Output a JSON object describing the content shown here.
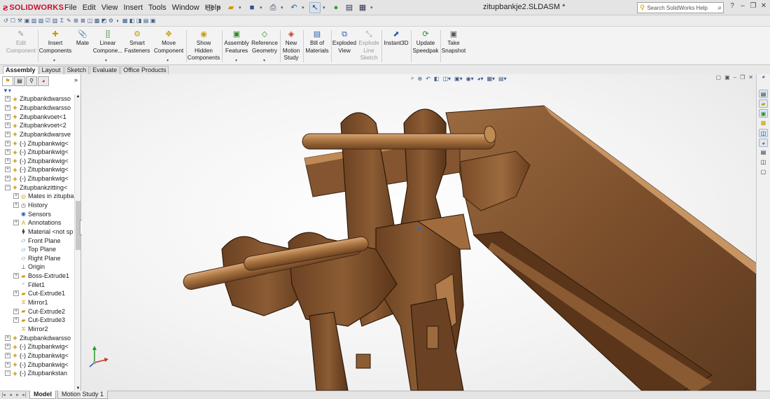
{
  "app": {
    "logo_text": "SOLIDWORKS",
    "document_title": "zitupbankje2.SLDASM *"
  },
  "menu": [
    "File",
    "Edit",
    "View",
    "Insert",
    "Tools",
    "Window",
    "Help"
  ],
  "search": {
    "placeholder": "Search SolidWorks Help"
  },
  "ribbon": {
    "buttons": [
      {
        "label": "Edit\nComponent",
        "enabled": false,
        "icon": "edit-component-icon"
      },
      {
        "label": "Insert\nComponents",
        "enabled": true,
        "icon": "insert-components-icon"
      },
      {
        "label": "Mate",
        "enabled": true,
        "icon": "mate-icon"
      },
      {
        "label": "Linear\nCompone...",
        "enabled": true,
        "icon": "linear-pattern-icon"
      },
      {
        "label": "Smart\nFasteners",
        "enabled": true,
        "icon": "smart-fasteners-icon"
      },
      {
        "label": "Move\nComponent",
        "enabled": true,
        "icon": "move-component-icon"
      },
      {
        "label": "Show\nHidden\nComponents",
        "enabled": true,
        "icon": "show-hidden-icon"
      },
      {
        "label": "Assembly\nFeatures",
        "enabled": true,
        "icon": "assembly-features-icon"
      },
      {
        "label": "Reference\nGeometry",
        "enabled": true,
        "icon": "reference-geometry-icon"
      },
      {
        "label": "New\nMotion\nStudy",
        "enabled": true,
        "icon": "motion-study-icon"
      },
      {
        "label": "Bill of\nMaterials",
        "enabled": true,
        "icon": "bom-icon"
      },
      {
        "label": "Exploded\nView",
        "enabled": true,
        "icon": "exploded-view-icon"
      },
      {
        "label": "Explode\nLine\nSketch",
        "enabled": false,
        "icon": "explode-line-icon"
      },
      {
        "label": "Instant3D",
        "enabled": true,
        "icon": "instant3d-icon"
      },
      {
        "label": "Update\nSpeedpak",
        "enabled": true,
        "icon": "speedpak-icon"
      },
      {
        "label": "Take\nSnapshot",
        "enabled": true,
        "icon": "snapshot-icon"
      }
    ]
  },
  "command_tabs": [
    {
      "label": "Assembly",
      "active": true
    },
    {
      "label": "Layout",
      "active": false
    },
    {
      "label": "Sketch",
      "active": false
    },
    {
      "label": "Evaluate",
      "active": false
    },
    {
      "label": "Office Products",
      "active": false
    }
  ],
  "tree": [
    {
      "label": "Zitupbankdwarsso",
      "level": 0,
      "toggle": "+",
      "icon": "component-icon"
    },
    {
      "label": "Zitupbankdwarsso",
      "level": 0,
      "toggle": "+",
      "icon": "component-icon"
    },
    {
      "label": "Zitupbankvoet<1",
      "level": 0,
      "toggle": "+",
      "icon": "component-icon"
    },
    {
      "label": "Zitupbankvoet<2",
      "level": 0,
      "toggle": "+",
      "icon": "component-icon"
    },
    {
      "label": "Zitupbankdwarsve",
      "level": 0,
      "toggle": "+",
      "icon": "component-icon"
    },
    {
      "label": "(-) Zitupbankwig<",
      "level": 0,
      "toggle": "+",
      "icon": "component-icon"
    },
    {
      "label": "(-) Zitupbankwig<",
      "level": 0,
      "toggle": "+",
      "icon": "component-icon"
    },
    {
      "label": "(-) Zitupbankwig<",
      "level": 0,
      "toggle": "+",
      "icon": "component-icon"
    },
    {
      "label": "(-) Zitupbankwig<",
      "level": 0,
      "toggle": "+",
      "icon": "component-icon"
    },
    {
      "label": "(-) Zitupbankwig<",
      "level": 0,
      "toggle": "+",
      "icon": "component-icon"
    },
    {
      "label": "Zitupbankzitting<",
      "level": 0,
      "toggle": "-",
      "icon": "component-icon"
    },
    {
      "label": "Mates in zitupba",
      "level": 1,
      "toggle": "+",
      "icon": "mates-icon"
    },
    {
      "label": "History",
      "level": 1,
      "toggle": "+",
      "icon": "history-icon"
    },
    {
      "label": "Sensors",
      "level": 1,
      "toggle": "",
      "icon": "sensors-icon"
    },
    {
      "label": "Annotations",
      "level": 1,
      "toggle": "+",
      "icon": "annotations-icon"
    },
    {
      "label": "Material <not sp",
      "level": 1,
      "toggle": "",
      "icon": "material-icon"
    },
    {
      "label": "Front Plane",
      "level": 1,
      "toggle": "",
      "icon": "plane-icon"
    },
    {
      "label": "Top Plane",
      "level": 1,
      "toggle": "",
      "icon": "plane-icon"
    },
    {
      "label": "Right Plane",
      "level": 1,
      "toggle": "",
      "icon": "plane-icon"
    },
    {
      "label": "Origin",
      "level": 1,
      "toggle": "",
      "icon": "origin-icon"
    },
    {
      "label": "Boss-Extrude1",
      "level": 1,
      "toggle": "+",
      "icon": "feature-icon"
    },
    {
      "label": "Fillet1",
      "level": 1,
      "toggle": "",
      "icon": "fillet-icon"
    },
    {
      "label": "Cut-Extrude1",
      "level": 1,
      "toggle": "+",
      "icon": "feature-icon"
    },
    {
      "label": "Mirror1",
      "level": 1,
      "toggle": "",
      "icon": "mirror-icon"
    },
    {
      "label": "Cut-Extrude2",
      "level": 1,
      "toggle": "+",
      "icon": "feature-icon"
    },
    {
      "label": "Cut-Extrude3",
      "level": 1,
      "toggle": "+",
      "icon": "feature-icon"
    },
    {
      "label": "Mirror2",
      "level": 1,
      "toggle": "",
      "icon": "mirror-icon"
    },
    {
      "label": "Zitupbankdwarsso",
      "level": 0,
      "toggle": "+",
      "icon": "component-icon"
    },
    {
      "label": "(-) Zitupbankwig<",
      "level": 0,
      "toggle": "+",
      "icon": "component-icon"
    },
    {
      "label": "(-) Zitupbankwig<",
      "level": 0,
      "toggle": "+",
      "icon": "component-icon"
    },
    {
      "label": "(-) Zitupbankwig<",
      "level": 0,
      "toggle": "+",
      "icon": "component-icon"
    },
    {
      "label": "(-) Zitupbankstan",
      "level": 0,
      "toggle": "-",
      "icon": "component-icon"
    }
  ],
  "bottom_tabs": [
    {
      "label": "Model",
      "active": true
    },
    {
      "label": "Motion Study 1",
      "active": false
    }
  ],
  "colors": {
    "wood_light": "#b07a4a",
    "wood_mid": "#7d4f2c",
    "wood_dark": "#4e2f17",
    "brand_red": "#c8102e"
  }
}
